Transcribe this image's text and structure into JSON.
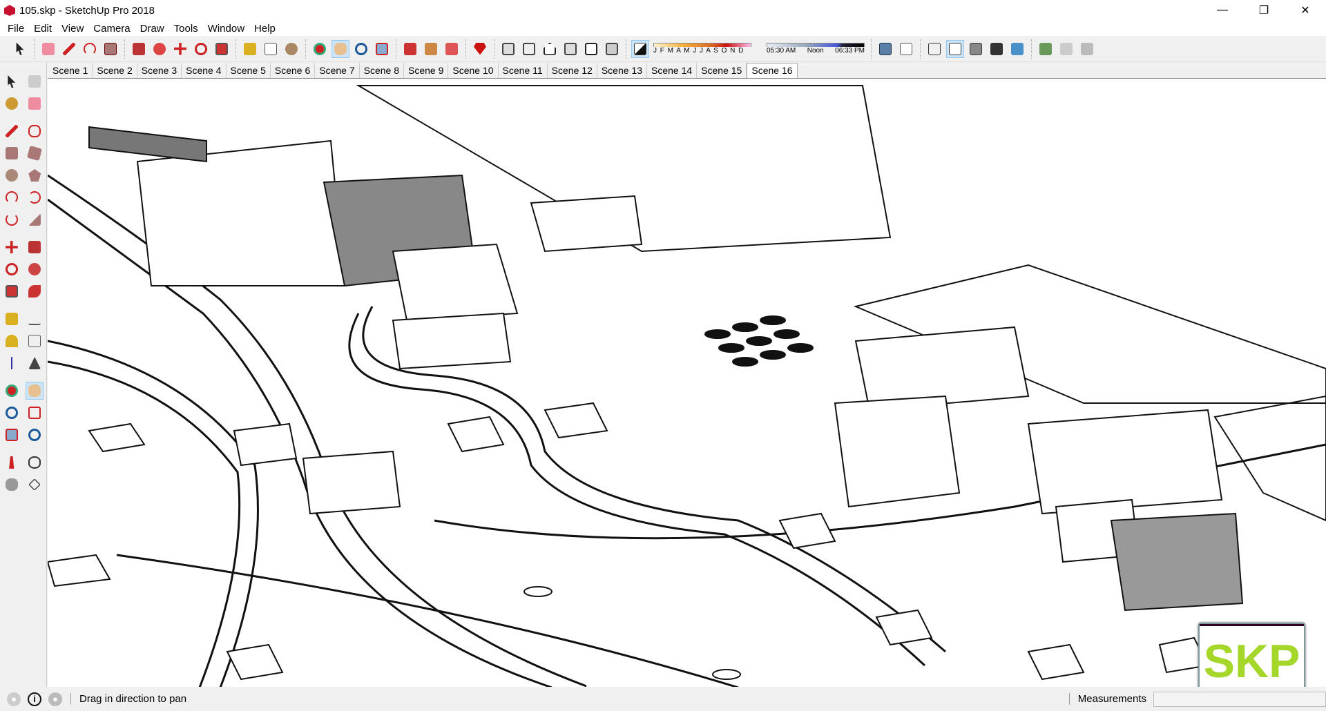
{
  "window": {
    "title": "105.skp - SketchUp Pro 2018",
    "minimize": "—",
    "maximize": "❐",
    "close": "✕"
  },
  "menu": [
    "File",
    "Edit",
    "View",
    "Camera",
    "Draw",
    "Tools",
    "Window",
    "Help"
  ],
  "shadows": {
    "months": "J F M A M J J A S O N D",
    "time_start": "05:30 AM",
    "time_mid": "Noon",
    "time_end": "06:33 PM"
  },
  "scenes": [
    "Scene 1",
    "Scene 2",
    "Scene 3",
    "Scene 4",
    "Scene 5",
    "Scene 6",
    "Scene 7",
    "Scene 8",
    "Scene 9",
    "Scene 10",
    "Scene 11",
    "Scene 12",
    "Scene 13",
    "Scene 14",
    "Scene 15",
    "Scene 16"
  ],
  "active_scene": "Scene 16",
  "status": {
    "message": "Drag in direction to pan",
    "measurements_label": "Measurements",
    "measurements_value": ""
  },
  "logo_text": "SKP",
  "colors": {
    "accent": "#cce4f7",
    "logo": "#a5d62a"
  }
}
